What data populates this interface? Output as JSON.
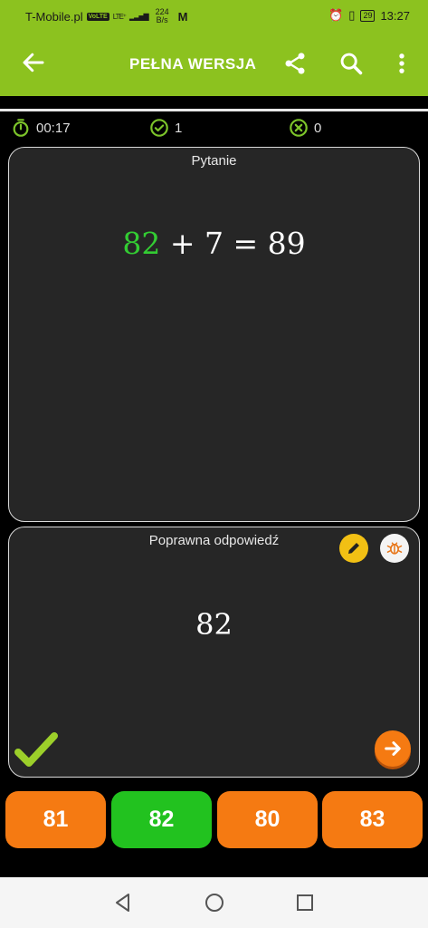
{
  "status": {
    "carrier": "T-Mobile.pl",
    "volte": "VoLTE",
    "network": "LTE⁺",
    "speed_value": "224",
    "speed_unit": "B/s",
    "battery": "29",
    "time": "13:27"
  },
  "appbar": {
    "title": "PEŁNA WERSJA",
    "icons": [
      "back-arrow-icon",
      "share-icon",
      "search-icon",
      "more-vertical-icon"
    ]
  },
  "stats": {
    "timer": "00:17",
    "correct": "1",
    "wrong": "0"
  },
  "question": {
    "label": "Pytanie",
    "operand_known": "82",
    "rest": " + 7 = 89"
  },
  "answer": {
    "label": "Poprawna odpowiedź",
    "value": "82"
  },
  "choices": [
    "81",
    "82",
    "80",
    "83"
  ],
  "colors": {
    "accent": "#8cc21f",
    "correct": "#22c21f",
    "choice": "#f57a12",
    "card": "#262626"
  }
}
